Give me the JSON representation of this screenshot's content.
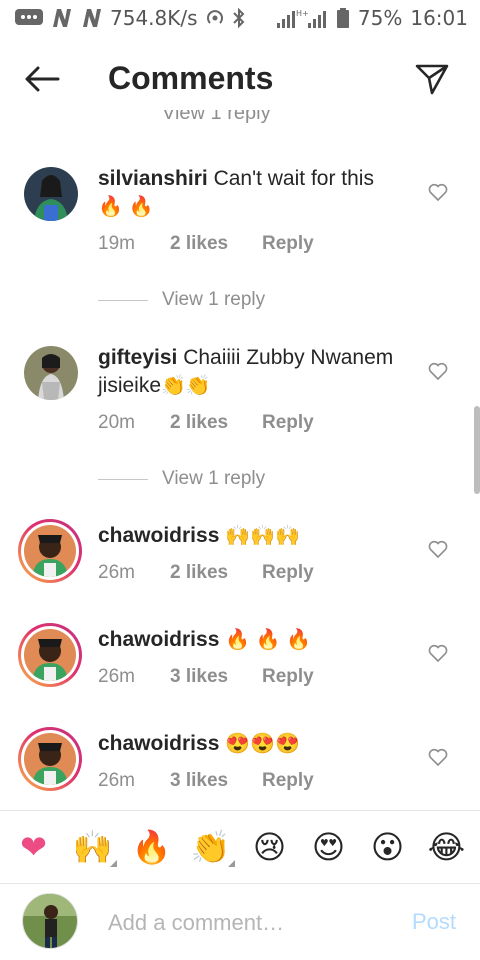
{
  "status_bar": {
    "speed": "754.8K/s",
    "battery": "75%",
    "time": "16:01"
  },
  "header": {
    "title": "Comments",
    "back_icon": "arrow-left-icon",
    "send_icon": "paper-plane-icon"
  },
  "partial_view_reply": "View 1 reply",
  "comments": [
    {
      "username": "silvianshiri",
      "text": "Can't wait for this",
      "emojis": "🔥 🔥",
      "time": "19m",
      "likes": "2 likes",
      "reply": "Reply",
      "view_replies": "View 1 reply"
    },
    {
      "username": "gifteyisi",
      "text": "Chaiiii Zubby Nwanem jisieike",
      "emojis": "👏👏",
      "time": "20m",
      "likes": "2 likes",
      "reply": "Reply",
      "view_replies": "View 1 reply"
    },
    {
      "username": "chawoidriss",
      "text": "",
      "emojis": "🙌🙌🙌",
      "time": "26m",
      "likes": "2 likes",
      "reply": "Reply"
    },
    {
      "username": "chawoidriss",
      "text": "",
      "emojis": "🔥 🔥 🔥",
      "time": "26m",
      "likes": "3 likes",
      "reply": "Reply"
    },
    {
      "username": "chawoidriss",
      "text": "",
      "emojis": "😍😍😍",
      "time": "26m",
      "likes": "3 likes",
      "reply": "Reply"
    }
  ],
  "emoji_bar": [
    "❤",
    "🙌",
    "🔥",
    "👏",
    "😢",
    "😍",
    "😮",
    "😂"
  ],
  "composer": {
    "placeholder": "Add a comment…",
    "post_label": "Post"
  },
  "colors": {
    "post_disabled": "#b3dbff",
    "heart_pink": "#ed4b83",
    "meta_gray": "#8e8e8e"
  }
}
